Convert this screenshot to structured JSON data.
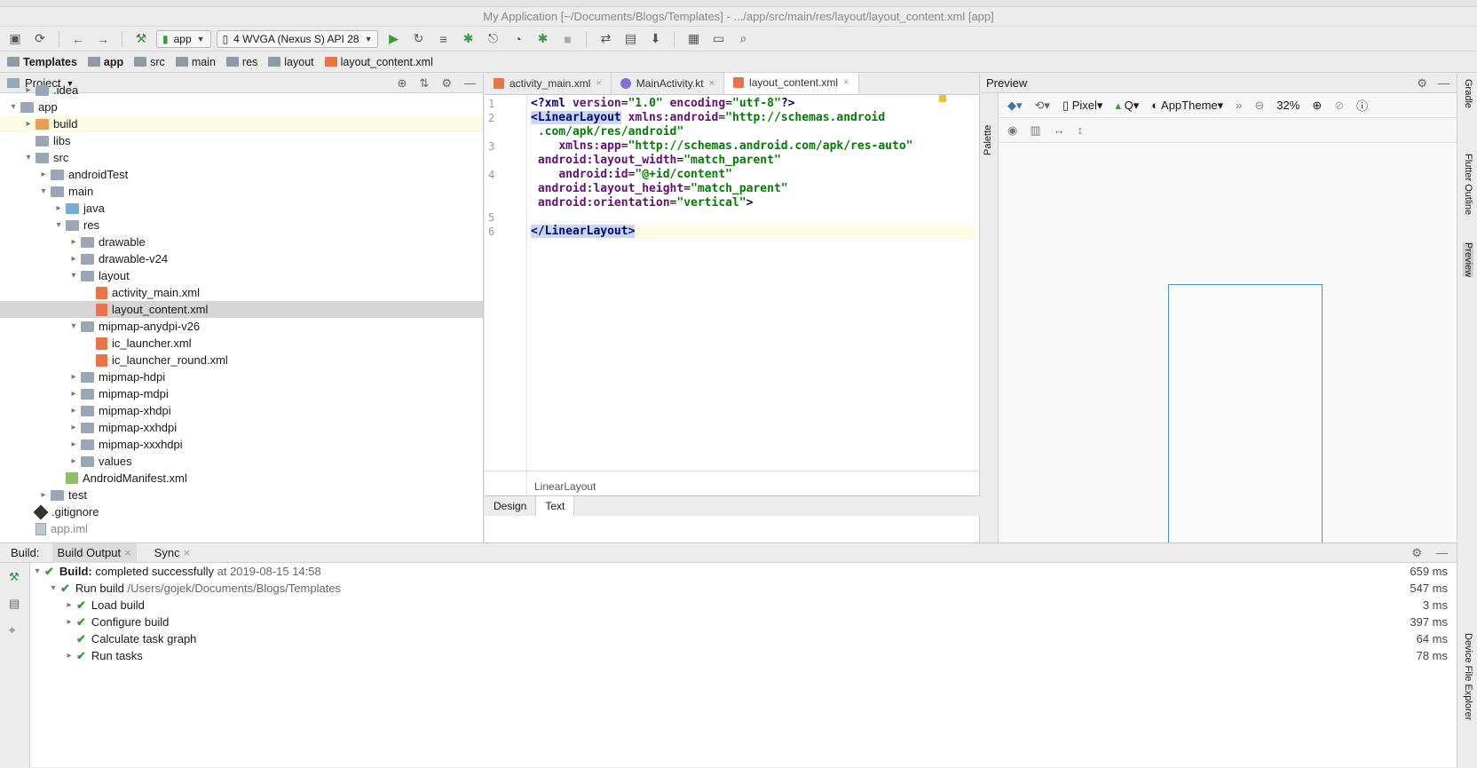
{
  "window": {
    "title": "My Application [~/Documents/Blogs/Templates] - .../app/src/main/res/layout/layout_content.xml [app]"
  },
  "toolbar": {
    "module": "app",
    "device": "4  WVGA (Nexus S) API 28"
  },
  "breadcrumbs": [
    "Templates",
    "app",
    "src",
    "main",
    "res",
    "layout",
    "layout_content.xml"
  ],
  "project": {
    "title": "Project",
    "tree": [
      {
        "label": ".idea",
        "depth": 2,
        "arrow": "▸",
        "icon": "folder"
      },
      {
        "label": "app",
        "depth": 1,
        "arrow": "▾",
        "icon": "folder"
      },
      {
        "label": "build",
        "depth": 2,
        "arrow": "▸",
        "icon": "folder-orange"
      },
      {
        "label": "libs",
        "depth": 2,
        "arrow": "",
        "icon": "folder"
      },
      {
        "label": "src",
        "depth": 2,
        "arrow": "▾",
        "icon": "folder"
      },
      {
        "label": "androidTest",
        "depth": 3,
        "arrow": "▸",
        "icon": "folder"
      },
      {
        "label": "main",
        "depth": 3,
        "arrow": "▾",
        "icon": "folder"
      },
      {
        "label": "java",
        "depth": 4,
        "arrow": "▸",
        "icon": "folder-blue"
      },
      {
        "label": "res",
        "depth": 4,
        "arrow": "▾",
        "icon": "folder"
      },
      {
        "label": "drawable",
        "depth": 5,
        "arrow": "▸",
        "icon": "folder"
      },
      {
        "label": "drawable-v24",
        "depth": 5,
        "arrow": "▸",
        "icon": "folder"
      },
      {
        "label": "layout",
        "depth": 5,
        "arrow": "▾",
        "icon": "folder"
      },
      {
        "label": "activity_main.xml",
        "depth": 6,
        "arrow": "",
        "icon": "xml"
      },
      {
        "label": "layout_content.xml",
        "depth": 6,
        "arrow": "",
        "icon": "xml"
      },
      {
        "label": "mipmap-anydpi-v26",
        "depth": 5,
        "arrow": "▾",
        "icon": "folder"
      },
      {
        "label": "ic_launcher.xml",
        "depth": 6,
        "arrow": "",
        "icon": "xml"
      },
      {
        "label": "ic_launcher_round.xml",
        "depth": 6,
        "arrow": "",
        "icon": "xml"
      },
      {
        "label": "mipmap-hdpi",
        "depth": 5,
        "arrow": "▸",
        "icon": "folder"
      },
      {
        "label": "mipmap-mdpi",
        "depth": 5,
        "arrow": "▸",
        "icon": "folder"
      },
      {
        "label": "mipmap-xhdpi",
        "depth": 5,
        "arrow": "▸",
        "icon": "folder"
      },
      {
        "label": "mipmap-xxhdpi",
        "depth": 5,
        "arrow": "▸",
        "icon": "folder"
      },
      {
        "label": "mipmap-xxxhdpi",
        "depth": 5,
        "arrow": "▸",
        "icon": "folder"
      },
      {
        "label": "values",
        "depth": 5,
        "arrow": "▸",
        "icon": "folder"
      },
      {
        "label": "AndroidManifest.xml",
        "depth": 4,
        "arrow": "",
        "icon": "manifest"
      },
      {
        "label": "test",
        "depth": 3,
        "arrow": "▸",
        "icon": "folder"
      },
      {
        "label": ".gitignore",
        "depth": 2,
        "arrow": "",
        "icon": "git"
      },
      {
        "label": "app.iml",
        "depth": 2,
        "arrow": "",
        "icon": "file"
      }
    ]
  },
  "editor": {
    "tabs": [
      {
        "label": "activity_main.xml",
        "icon": "xml"
      },
      {
        "label": "MainActivity.kt",
        "icon": "kt"
      },
      {
        "label": "layout_content.xml",
        "icon": "xml"
      }
    ],
    "line_numbers": [
      "1",
      "2",
      "",
      "3",
      "",
      "4",
      "",
      "",
      "5",
      "6"
    ],
    "footer": "LinearLayout",
    "mode_tabs": [
      "Design",
      "Text"
    ]
  },
  "preview": {
    "title": "Preview",
    "side_label": "Palette",
    "device": "Pixel",
    "api": "Q",
    "theme": "AppTheme",
    "zoom": "32%"
  },
  "right_strip": [
    "Gradle",
    "Flutter Outline",
    "Preview",
    "Device File Explorer"
  ],
  "build": {
    "label": "Build:",
    "tabs": [
      "Build Output",
      "Sync"
    ],
    "rows": [
      {
        "indent": 0,
        "arrow": "▾",
        "bold": "Build:",
        "text": " completed successfully",
        "muted": " at 2019-08-15 14:58",
        "ms": "659 ms"
      },
      {
        "indent": 1,
        "arrow": "▾",
        "bold": "",
        "text": "Run build",
        "muted": " /Users/gojek/Documents/Blogs/Templates",
        "ms": "547 ms"
      },
      {
        "indent": 2,
        "arrow": "▸",
        "bold": "",
        "text": "Load build",
        "muted": "",
        "ms": "3 ms"
      },
      {
        "indent": 2,
        "arrow": "▸",
        "bold": "",
        "text": "Configure build",
        "muted": "",
        "ms": "397 ms"
      },
      {
        "indent": 2,
        "arrow": "",
        "bold": "",
        "text": "Calculate task graph",
        "muted": "",
        "ms": "64 ms"
      },
      {
        "indent": 2,
        "arrow": "▸",
        "bold": "",
        "text": "Run tasks",
        "muted": "",
        "ms": "78 ms"
      }
    ]
  }
}
